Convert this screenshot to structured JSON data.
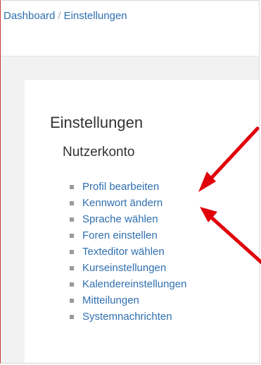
{
  "breadcrumb": {
    "items": [
      "Dashboard",
      "Einstellungen"
    ],
    "separator": "/"
  },
  "page": {
    "title": "Einstellungen"
  },
  "section": {
    "title": "Nutzerkonto",
    "items": [
      {
        "label": "Profil bearbeiten"
      },
      {
        "label": "Kennwort ändern"
      },
      {
        "label": "Sprache wählen"
      },
      {
        "label": "Foren einstellen"
      },
      {
        "label": "Texteditor wählen"
      },
      {
        "label": "Kurseinstellungen"
      },
      {
        "label": "Kalendereinstellungen"
      },
      {
        "label": "Mitteilungen"
      },
      {
        "label": "Systemnachrichten"
      }
    ]
  },
  "annotations": {
    "arrow_color": "#e0000a",
    "arrows": [
      {
        "points_to": "Profil bearbeiten"
      },
      {
        "points_to": "Kennwort ändern"
      }
    ]
  }
}
